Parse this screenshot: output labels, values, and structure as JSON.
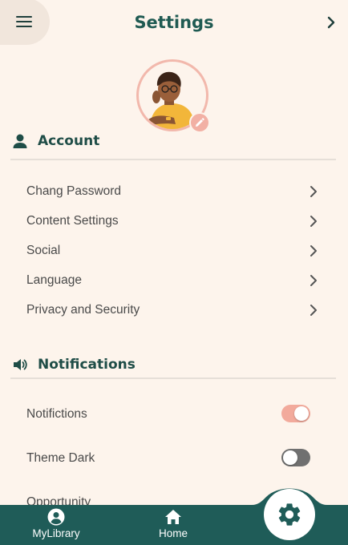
{
  "header": {
    "title": "Settings",
    "menu_icon": "hamburger-menu-icon",
    "next_icon": "chevron-right-icon"
  },
  "profile": {
    "avatar": "user-avatar",
    "edit_icon": "pencil-icon"
  },
  "account": {
    "title": "Account",
    "icon": "person-icon",
    "items": [
      {
        "label": "Chang Password"
      },
      {
        "label": "Content Settings"
      },
      {
        "label": "Social"
      },
      {
        "label": "Language"
      },
      {
        "label": "Privacy and Security"
      }
    ]
  },
  "notifications": {
    "title": "Notifications",
    "icon": "speaker-icon",
    "items": [
      {
        "label": "Notifictions",
        "enabled": true
      },
      {
        "label": "Theme Dark",
        "enabled": false
      },
      {
        "label": "Opportunity"
      }
    ]
  },
  "bottom_nav": {
    "items": [
      {
        "label": "MyLibrary",
        "icon": "account-circle-icon"
      },
      {
        "label": "Home",
        "icon": "home-icon"
      }
    ],
    "fab_icon": "gear-icon"
  },
  "colors": {
    "background": "#fdf4ec",
    "primary": "#1f5a52",
    "accent": "#f2aa9c",
    "nav": "#1f5c58"
  }
}
